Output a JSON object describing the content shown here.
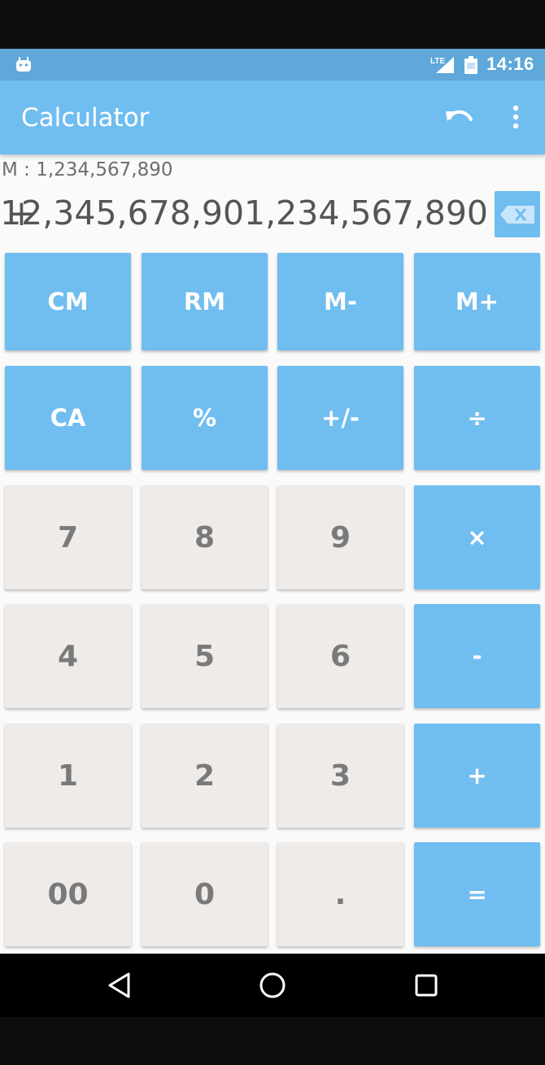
{
  "status_bar": {
    "time": "14:16",
    "left_icon": "android-notification-icon",
    "network_label": "LTE",
    "icons": [
      "lte-signal-icon",
      "battery-icon"
    ]
  },
  "app_bar": {
    "title": "Calculator",
    "actions": [
      "undo-icon",
      "more-vert-icon"
    ]
  },
  "display": {
    "memory": "M : 1,234,567,890",
    "operator": "+",
    "value": "12,345,678,901,234,567,890",
    "backspace_icon": "backspace-icon"
  },
  "keypad": {
    "rows": [
      [
        {
          "label": "CM",
          "style": "blue"
        },
        {
          "label": "RM",
          "style": "blue"
        },
        {
          "label": "M-",
          "style": "blue"
        },
        {
          "label": "M+",
          "style": "blue"
        }
      ],
      [
        {
          "label": "CA",
          "style": "blue"
        },
        {
          "label": "%",
          "style": "blue"
        },
        {
          "label": "+/-",
          "style": "blue"
        },
        {
          "label": "÷",
          "style": "blue"
        }
      ],
      [
        {
          "label": "7",
          "style": "grey"
        },
        {
          "label": "8",
          "style": "grey"
        },
        {
          "label": "9",
          "style": "grey"
        },
        {
          "label": "×",
          "style": "blue"
        }
      ],
      [
        {
          "label": "4",
          "style": "grey"
        },
        {
          "label": "5",
          "style": "grey"
        },
        {
          "label": "6",
          "style": "grey"
        },
        {
          "label": "-",
          "style": "blue"
        }
      ],
      [
        {
          "label": "1",
          "style": "grey"
        },
        {
          "label": "2",
          "style": "grey"
        },
        {
          "label": "3",
          "style": "grey"
        },
        {
          "label": "+",
          "style": "blue"
        }
      ],
      [
        {
          "label": "00",
          "style": "grey"
        },
        {
          "label": "0",
          "style": "grey"
        },
        {
          "label": ".",
          "style": "grey"
        },
        {
          "label": "=",
          "style": "blue"
        }
      ]
    ]
  },
  "nav_bar": {
    "buttons": [
      "back-icon",
      "home-icon",
      "recents-icon"
    ]
  },
  "colors": {
    "accent": "#70bdf0",
    "status_bar": "#5fa8d9",
    "digit_key": "#eeebe8",
    "digit_text": "#7a7a7a"
  }
}
